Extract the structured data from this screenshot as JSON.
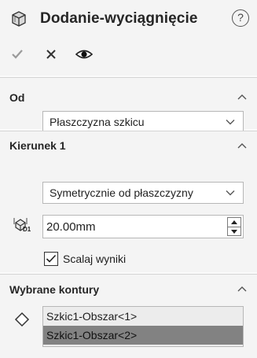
{
  "header": {
    "title": "Dodanie-wyciągnięcie",
    "help_label": "?",
    "icons": [
      "extrude-boss-icon",
      "help-icon",
      "ok-check-icon",
      "cancel-x-icon",
      "detailed-preview-eye-icon"
    ]
  },
  "section_from": {
    "title": "Od",
    "start_condition": "Płaszczyzna szkicu"
  },
  "section_direction1": {
    "title": "Kierunek 1",
    "end_condition": "Symetrycznie od płaszczyzny",
    "depth_value": "20.00mm",
    "depth_icon_label": "D1",
    "merge_label": "Scalaj wyniki",
    "merge_checked": true
  },
  "section_contours": {
    "title": "Wybrane kontury",
    "items": [
      "Szkic1-Obszar<1>",
      "Szkic1-Obszar<2>"
    ],
    "selected_index": 1
  },
  "colors": {
    "panel_bg": "#f4f4f4",
    "selected_item_bg": "#828282",
    "list_bg": "#ececec"
  }
}
